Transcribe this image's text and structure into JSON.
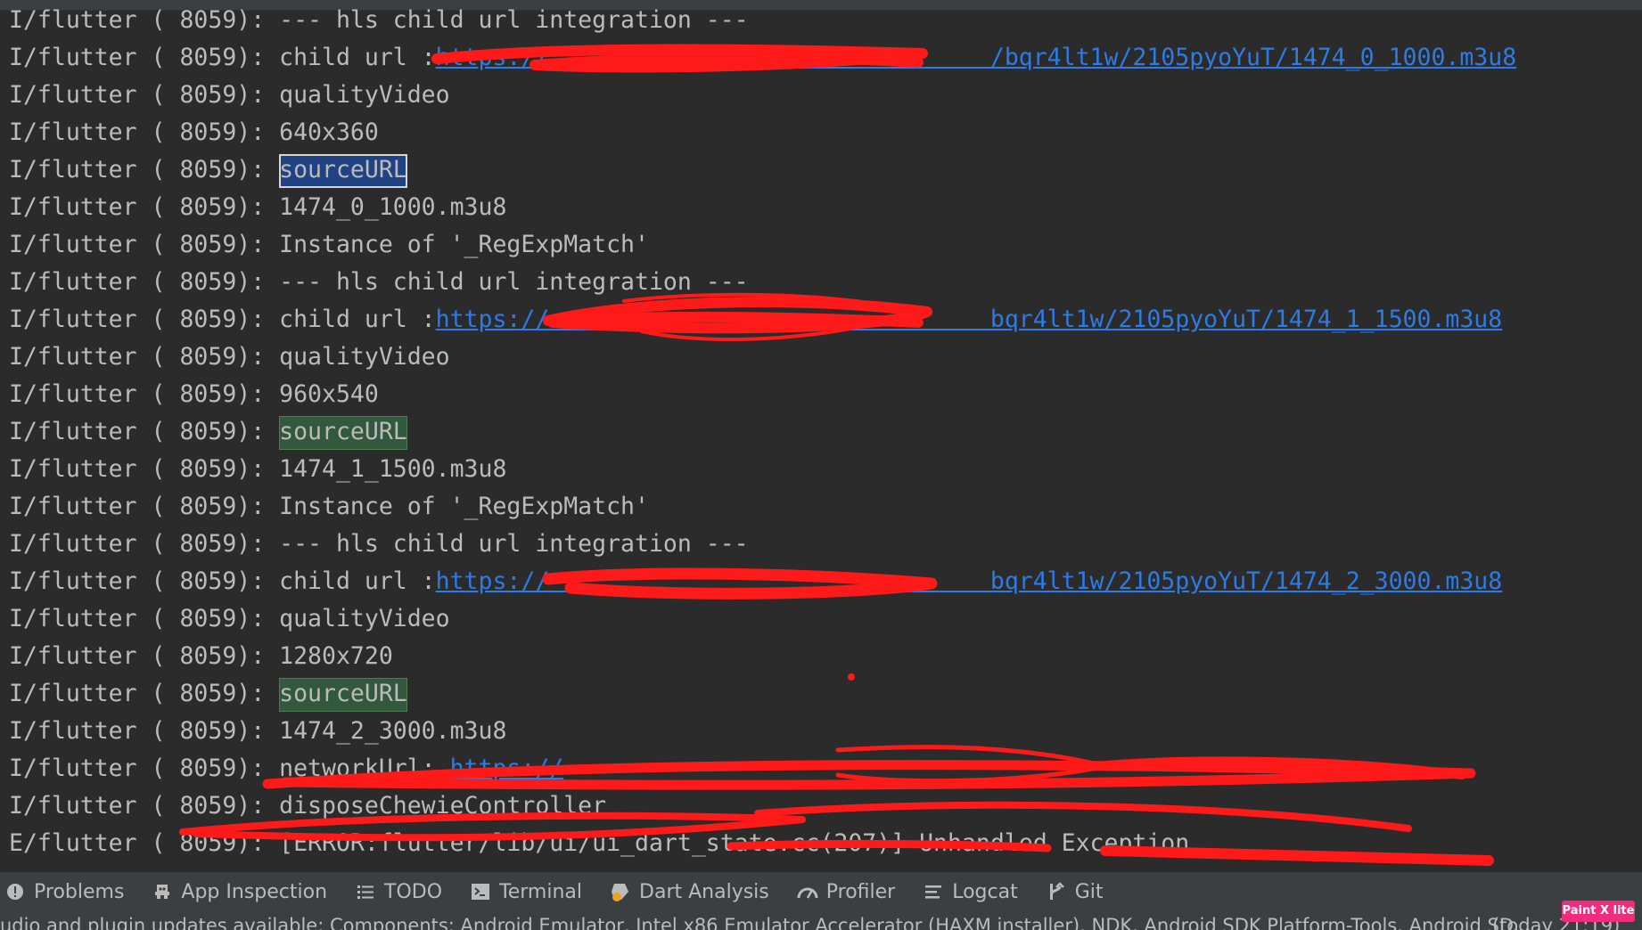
{
  "console": {
    "lines": [
      {
        "prefix": "I/flutter ( 8059): ",
        "text": "--- hls child url integration ---"
      },
      {
        "prefix": "I/flutter ( 8059): ",
        "text": "child url :",
        "link": "https://                               /bqr4lt1w/2105pyoYuT/1474_0_1000.m3u8"
      },
      {
        "prefix": "I/flutter ( 8059): ",
        "text": "qualityVideo"
      },
      {
        "prefix": "I/flutter ( 8059): ",
        "text": "640x360"
      },
      {
        "prefix": "I/flutter ( 8059): ",
        "highlight": "sourceURL",
        "highlight_state": "active"
      },
      {
        "prefix": "I/flutter ( 8059): ",
        "text": "1474_0_1000.m3u8"
      },
      {
        "prefix": "I/flutter ( 8059): ",
        "text": "Instance of '_RegExpMatch'"
      },
      {
        "prefix": "I/flutter ( 8059): ",
        "text": "--- hls child url integration ---"
      },
      {
        "prefix": "I/flutter ( 8059): ",
        "text": "child url :",
        "link": "https://                               bqr4lt1w/2105pyoYuT/1474_1_1500.m3u8"
      },
      {
        "prefix": "I/flutter ( 8059): ",
        "text": "qualityVideo"
      },
      {
        "prefix": "I/flutter ( 8059): ",
        "text": "960x540"
      },
      {
        "prefix": "I/flutter ( 8059): ",
        "highlight": "sourceURL",
        "highlight_state": "match"
      },
      {
        "prefix": "I/flutter ( 8059): ",
        "text": "1474_1_1500.m3u8"
      },
      {
        "prefix": "I/flutter ( 8059): ",
        "text": "Instance of '_RegExpMatch'"
      },
      {
        "prefix": "I/flutter ( 8059): ",
        "text": "--- hls child url integration ---"
      },
      {
        "prefix": "I/flutter ( 8059): ",
        "text": "child url :",
        "link": "https://                               bqr4lt1w/2105pyoYuT/1474_2_3000.m3u8"
      },
      {
        "prefix": "I/flutter ( 8059): ",
        "text": "qualityVideo"
      },
      {
        "prefix": "I/flutter ( 8059): ",
        "text": "1280x720"
      },
      {
        "prefix": "I/flutter ( 8059): ",
        "highlight": "sourceURL",
        "highlight_state": "match"
      },
      {
        "prefix": "I/flutter ( 8059): ",
        "text": "1474_2_3000.m3u8"
      },
      {
        "prefix": "I/flutter ( 8059): ",
        "text": "networkUrl: ",
        "link": "https://"
      },
      {
        "prefix": "I/flutter ( 8059): ",
        "text": "disposeChewieController"
      },
      {
        "prefix": "E/flutter ( 8059): ",
        "text": "[ERROR:flutter/lib/ui/ui_dart_state.cc(207)] Unhandled Exception",
        "level": "error"
      }
    ]
  },
  "toolbar": {
    "tabs": [
      {
        "label": "Problems",
        "icon": "info-circle-icon"
      },
      {
        "label": "App Inspection",
        "icon": "app-inspection-icon"
      },
      {
        "label": "TODO",
        "icon": "list-icon"
      },
      {
        "label": "Terminal",
        "icon": "terminal-icon"
      },
      {
        "label": "Dart Analysis",
        "icon": "dart-analysis-icon"
      },
      {
        "label": "Profiler",
        "icon": "gauge-icon"
      },
      {
        "label": "Logcat",
        "icon": "logcat-icon"
      },
      {
        "label": "Git",
        "icon": "git-branch-icon"
      }
    ]
  },
  "statusbar": {
    "text": "udio and plugin updates available: Components: Android Emulator, Intel x86 Emulator Accelerator (HAXM installer), NDK, Android SDK Platform-Tools, Android SD...",
    "time": "(today 21:19)"
  },
  "badge": {
    "label": "Paint X lite"
  },
  "colors": {
    "background": "#2b2b2b",
    "text": "#bbbbbb",
    "link": "#2d7be5",
    "highlight_active": "#214283",
    "highlight_match": "#32593d",
    "scribble": "#ff0000",
    "badge": "#f02d7d"
  }
}
